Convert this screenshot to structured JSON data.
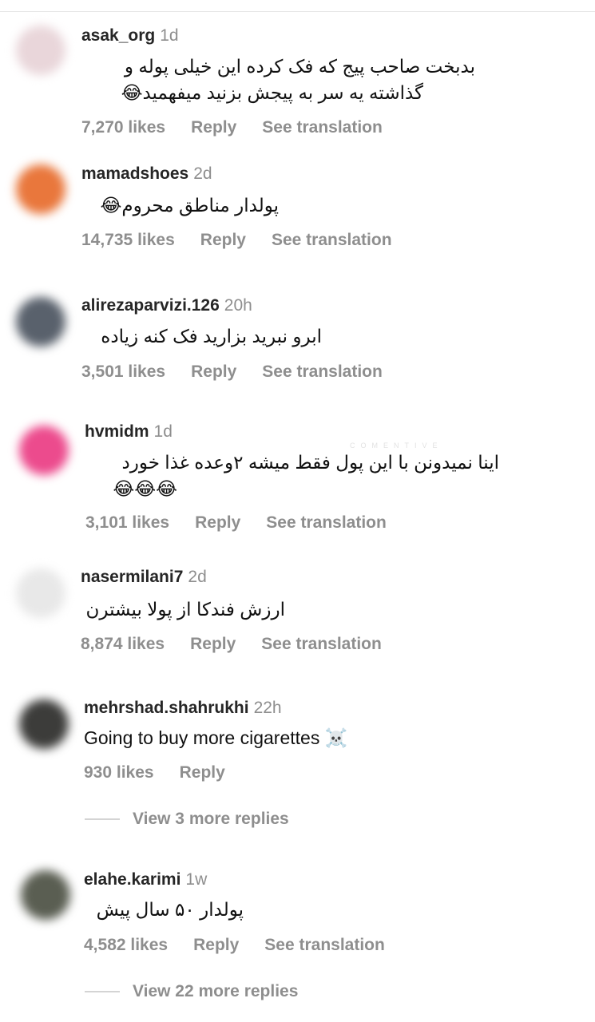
{
  "watermark": "COMENTIVE",
  "comments": [
    {
      "username": "asak_org",
      "time": "1d",
      "lines": [
        "بدبخت صاحب پیج که فک کرده این خیلی پوله و",
        "گذاشته یه سر به پیجش بزنید میفهمید😂"
      ],
      "likes": "7,270 likes",
      "reply": "Reply",
      "translate": "See translation",
      "avatar_color": "#e9d6da"
    },
    {
      "username": "mamadshoes",
      "time": "2d",
      "lines": [
        "پولدار مناطق محروم😂"
      ],
      "likes": "14,735 likes",
      "reply": "Reply",
      "translate": "See translation",
      "avatar_color": "#e9773c"
    },
    {
      "username": "alirezaparvizi.126",
      "time": "20h",
      "lines": [
        "ابرو نبرید بزارید فک کنه زیاده"
      ],
      "likes": "3,501 likes",
      "reply": "Reply",
      "translate": "See translation",
      "avatar_color": "#59616c"
    },
    {
      "username": "hvmidm",
      "time": "1d",
      "lines": [
        "اینا نمیدونن با این پول فقط میشه ۲وعده غذا خورد",
        "😂😂😂"
      ],
      "likes": "3,101 likes",
      "reply": "Reply",
      "translate": "See translation",
      "avatar_color": "#ec4b8d"
    },
    {
      "username": "nasermilani7",
      "time": "2d",
      "lines": [
        "ارزش فندکا از پولا بیشترن"
      ],
      "likes": "8,874 likes",
      "reply": "Reply",
      "translate": "See translation",
      "avatar_color": "#e8e8e8"
    },
    {
      "username": "mehrshad.shahrukhi",
      "time": "22h",
      "lines": [
        "Going to buy more cigarettes ☠️"
      ],
      "likes": "930 likes",
      "reply": "Reply",
      "view_replies": "View 3 more replies",
      "avatar_color": "#3c3c3a"
    },
    {
      "username": "elahe.karimi",
      "time": "1w",
      "lines": [
        "پولدار ۵۰ سال پیش"
      ],
      "likes": "4,582 likes",
      "reply": "Reply",
      "translate": "See translation",
      "view_replies": "View 22 more replies",
      "avatar_color": "#5a5e52"
    }
  ]
}
